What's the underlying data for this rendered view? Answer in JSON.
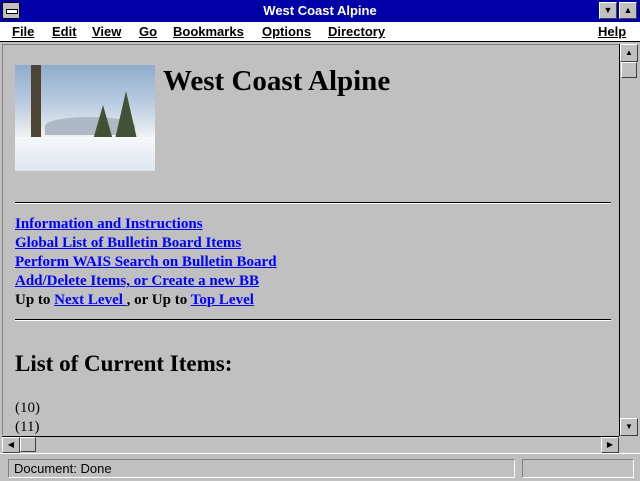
{
  "window": {
    "title": "West Coast Alpine"
  },
  "menubar": {
    "items": [
      "File",
      "Edit",
      "View",
      "Go",
      "Bookmarks",
      "Options",
      "Directory",
      "Help"
    ]
  },
  "page": {
    "heading": "West Coast Alpine",
    "links": [
      "Information and Instructions",
      "Global List of Bulletin Board Items",
      "Perform WAIS Search on Bulletin Board",
      "Add/Delete Items, or Create a new BB"
    ],
    "nav": {
      "prefix1": "Up to ",
      "link1": "Next Level ",
      "middle": ", or Up to ",
      "link2": "Top Level "
    },
    "section_title": "List of Current Items:",
    "items": [
      "(10)",
      "(11)"
    ]
  },
  "statusbar": {
    "text": "Document: Done",
    "progress": 0
  },
  "colors": {
    "titlebar": "#0000a8",
    "link": "#0000ff",
    "background": "#c0c0c0"
  },
  "icons": {
    "system_menu": "system-menu-icon",
    "minimize": "minimize-arrow-icon",
    "maximize": "maximize-arrow-icon",
    "scroll_up": "scroll-up-arrow-icon",
    "scroll_down": "scroll-down-arrow-icon",
    "scroll_left": "scroll-left-arrow-icon",
    "scroll_right": "scroll-right-arrow-icon"
  }
}
